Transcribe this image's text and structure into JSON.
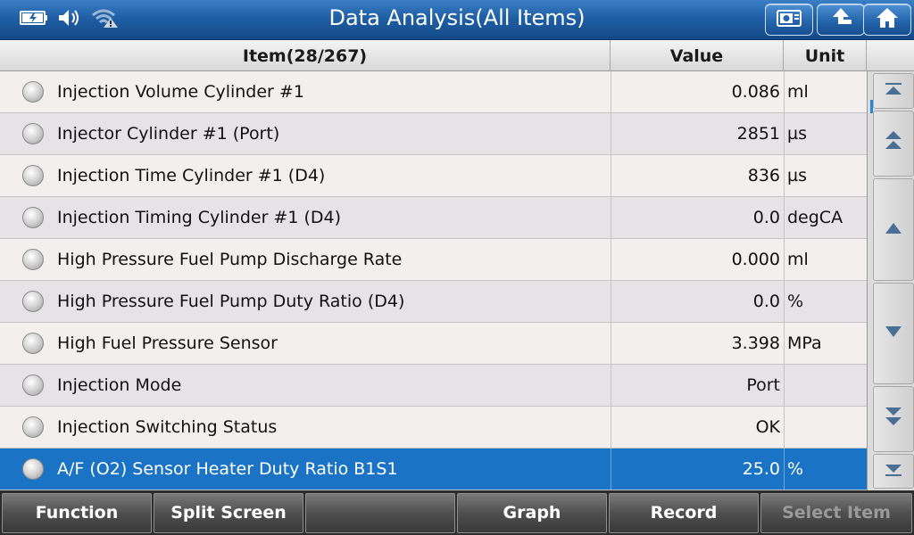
{
  "titlebar": {
    "title": "Data Analysis(All Items)",
    "status_icons": [
      "battery-icon",
      "speaker-icon",
      "wifi-warning-icon"
    ],
    "buttons": [
      "screenshot-icon",
      "back-icon",
      "home-icon"
    ]
  },
  "table": {
    "header": {
      "item": "Item(28/267)",
      "value": "Value",
      "unit": "Unit"
    },
    "rows": [
      {
        "item": "Injection Volume Cylinder #1",
        "value": "0.086",
        "unit": "ml",
        "selected": false
      },
      {
        "item": "Injector Cylinder #1 (Port)",
        "value": "2851",
        "unit": "µs",
        "selected": false
      },
      {
        "item": "Injection Time Cylinder #1 (D4)",
        "value": "836",
        "unit": "µs",
        "selected": false
      },
      {
        "item": "Injection Timing Cylinder #1 (D4)",
        "value": "0.0",
        "unit": "degCA",
        "selected": false
      },
      {
        "item": "High Pressure Fuel Pump Discharge Rate",
        "value": "0.000",
        "unit": "ml",
        "selected": false
      },
      {
        "item": "High Pressure Fuel Pump Duty Ratio (D4)",
        "value": "0.0",
        "unit": "%",
        "selected": false
      },
      {
        "item": "High Fuel Pressure Sensor",
        "value": "3.398",
        "unit": "MPa",
        "selected": false
      },
      {
        "item": "Injection Mode",
        "value": "Port",
        "unit": "",
        "selected": false
      },
      {
        "item": "Injection Switching Status",
        "value": "OK",
        "unit": "",
        "selected": false
      },
      {
        "item": "A/F (O2) Sensor Heater Duty Ratio B1S1",
        "value": "25.0",
        "unit": "%",
        "selected": true
      }
    ]
  },
  "scrollbar": {
    "buttons": [
      "scroll-top-icon",
      "page-up-icon",
      "line-up-icon",
      "line-down-icon",
      "page-down-icon",
      "scroll-bottom-icon"
    ]
  },
  "bottombar": {
    "function": "Function",
    "split_screen": "Split Screen",
    "empty": "",
    "graph": "Graph",
    "record": "Record",
    "select_item": "Select Item"
  },
  "colors": {
    "title_bar": "#1f5fa5",
    "selected_row": "#1a73c4",
    "bottom_bar": "#2d2d2d"
  }
}
